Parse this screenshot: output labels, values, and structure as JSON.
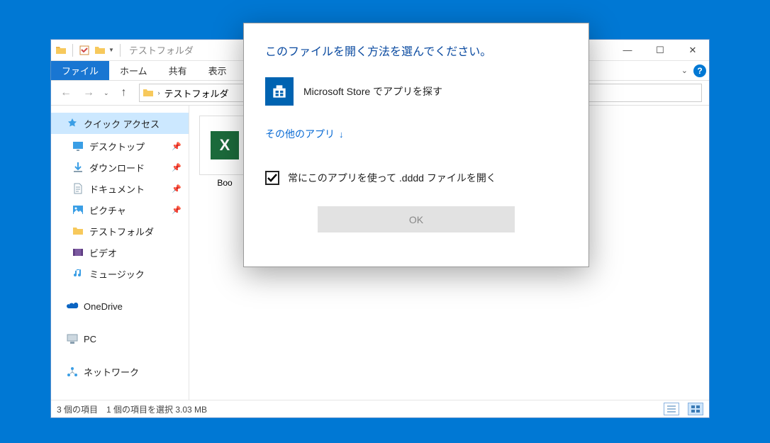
{
  "window": {
    "title": "テストフォルダ",
    "controls": {
      "minimize": "—",
      "maximize": "☐",
      "close": "✕"
    }
  },
  "ribbon": {
    "file": "ファイル",
    "home": "ホーム",
    "share": "共有",
    "view": "表示"
  },
  "nav": {
    "back": "←",
    "forward": "→",
    "up": "↑"
  },
  "address": {
    "crumb": "テストフォルダ"
  },
  "sidebar": {
    "quick_access": "クイック アクセス",
    "items": [
      {
        "icon": "desktop",
        "label": "デスクトップ",
        "pinned": true
      },
      {
        "icon": "download",
        "label": "ダウンロード",
        "pinned": true
      },
      {
        "icon": "document",
        "label": "ドキュメント",
        "pinned": true
      },
      {
        "icon": "picture",
        "label": "ピクチャ",
        "pinned": true
      },
      {
        "icon": "folder",
        "label": "テストフォルダ",
        "pinned": false
      },
      {
        "icon": "video",
        "label": "ビデオ",
        "pinned": false
      },
      {
        "icon": "music",
        "label": "ミュージック",
        "pinned": false
      }
    ],
    "onedrive": "OneDrive",
    "pc": "PC",
    "network": "ネットワーク"
  },
  "content": {
    "file0_label": "Boo"
  },
  "statusbar": {
    "count": "3 個の項目",
    "selected": "1 個の項目を選択 3.03 MB"
  },
  "dialog": {
    "heading": "このファイルを開く方法を選んでください。",
    "store_option": "Microsoft Store でアプリを探す",
    "more_apps": "その他のアプリ",
    "always_label": "常にこのアプリを使って .dddd ファイルを開く",
    "ok": "OK"
  }
}
